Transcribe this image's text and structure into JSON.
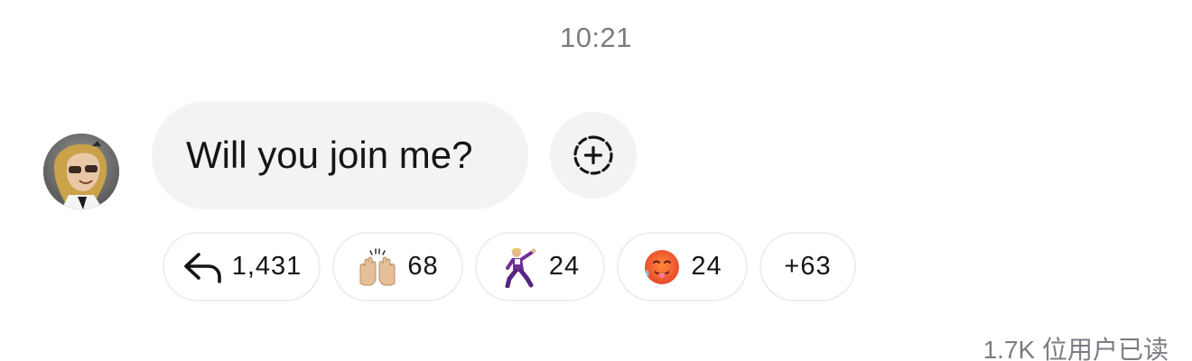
{
  "conversation": {
    "timestamp": "10:21"
  },
  "message": {
    "text": "Will you join me?",
    "sender_avatar": "profile-photo-icon"
  },
  "actions": {
    "add_reaction_icon": "dashed-circle-plus-icon"
  },
  "reactions": [
    {
      "icon": "reply-arrow-icon",
      "count": "1,431"
    },
    {
      "icon": "raising-hands-emoji-icon",
      "count": "68"
    },
    {
      "icon": "dancing-man-emoji-icon",
      "count": "24"
    },
    {
      "icon": "hot-face-emoji-icon",
      "count": "24"
    },
    {
      "icon": "",
      "count": "+63"
    }
  ],
  "read_receipt": "1.7K 位用户已读",
  "colors": {
    "bubble": "#f2f3f5",
    "muted_text": "#7a7d82",
    "text": "#151515"
  }
}
